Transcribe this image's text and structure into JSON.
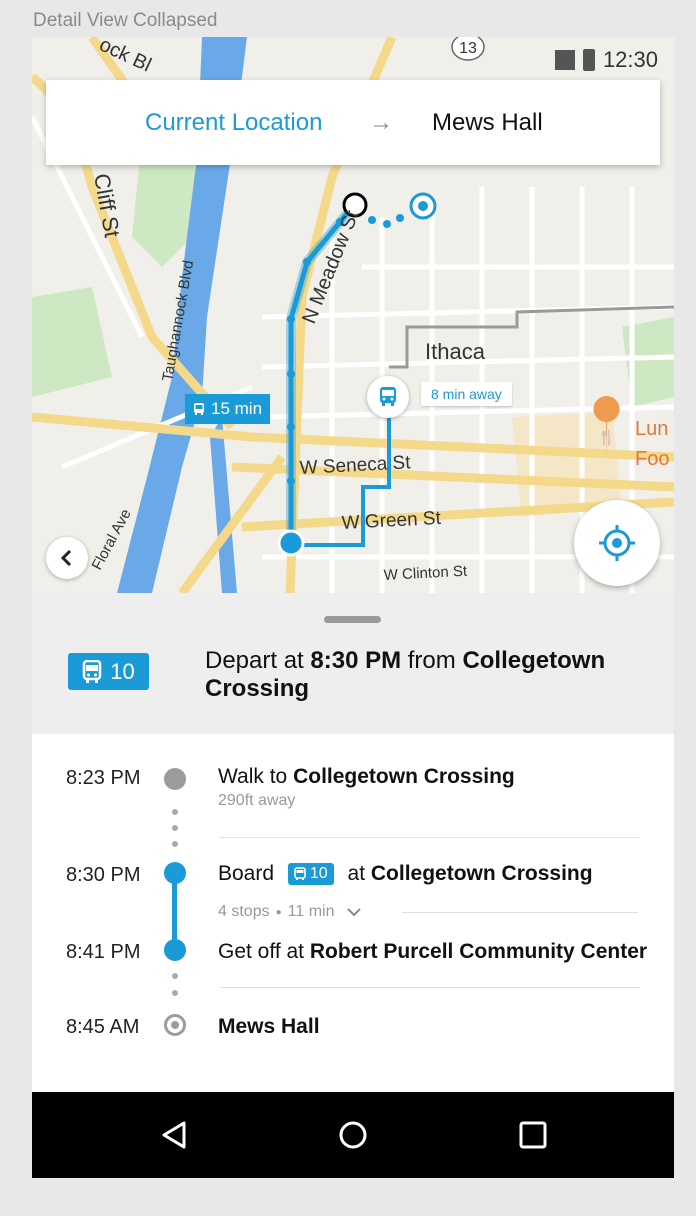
{
  "caption": "Detail View Collapsed",
  "status_bar": {
    "time": "12:30"
  },
  "route_header": {
    "from": "Current Location",
    "arrow": "→",
    "to": "Mews Hall"
  },
  "map": {
    "route_badge_number": "13",
    "labels": {
      "cliff_st": "Cliff St",
      "taughannock": "Taughannock Blvd",
      "n_meadow": "N Meadow St",
      "ithaca": "Ithaca",
      "w_seneca": "W Seneca St",
      "w_green": "W Green St",
      "w_clinton": "W Clinton St",
      "floral_ave": "Floral Ave",
      "lun": "Lun",
      "foo": "Foo",
      "rock": "ock Bl"
    },
    "walk_time": "15 min",
    "bus_away": "8 min away"
  },
  "sheet": {
    "bus_number": "10",
    "depart_prefix": "Depart at",
    "depart_time": "8:30 PM",
    "depart_mid": "from",
    "depart_stop": "Collegetown Crossing"
  },
  "steps": [
    {
      "time": "8:23 PM",
      "prefix": "Walk to",
      "place": "Collegetown Crossing",
      "sub": "290ft away"
    },
    {
      "time": "8:30 PM",
      "prefix": "Board",
      "bus": "10",
      "mid": "at",
      "place": "Collegetown Crossing",
      "stops": "4 stops",
      "duration": "11 min"
    },
    {
      "time": "8:41 PM",
      "prefix": "Get off at",
      "place": "Robert Purcell Community Center"
    },
    {
      "time": "8:45 AM",
      "place": "Mews Hall"
    }
  ],
  "colors": {
    "accent": "#1a9ad6",
    "road": "#f5d98b",
    "water": "#6aa9e8",
    "park": "#cfe8c4"
  }
}
